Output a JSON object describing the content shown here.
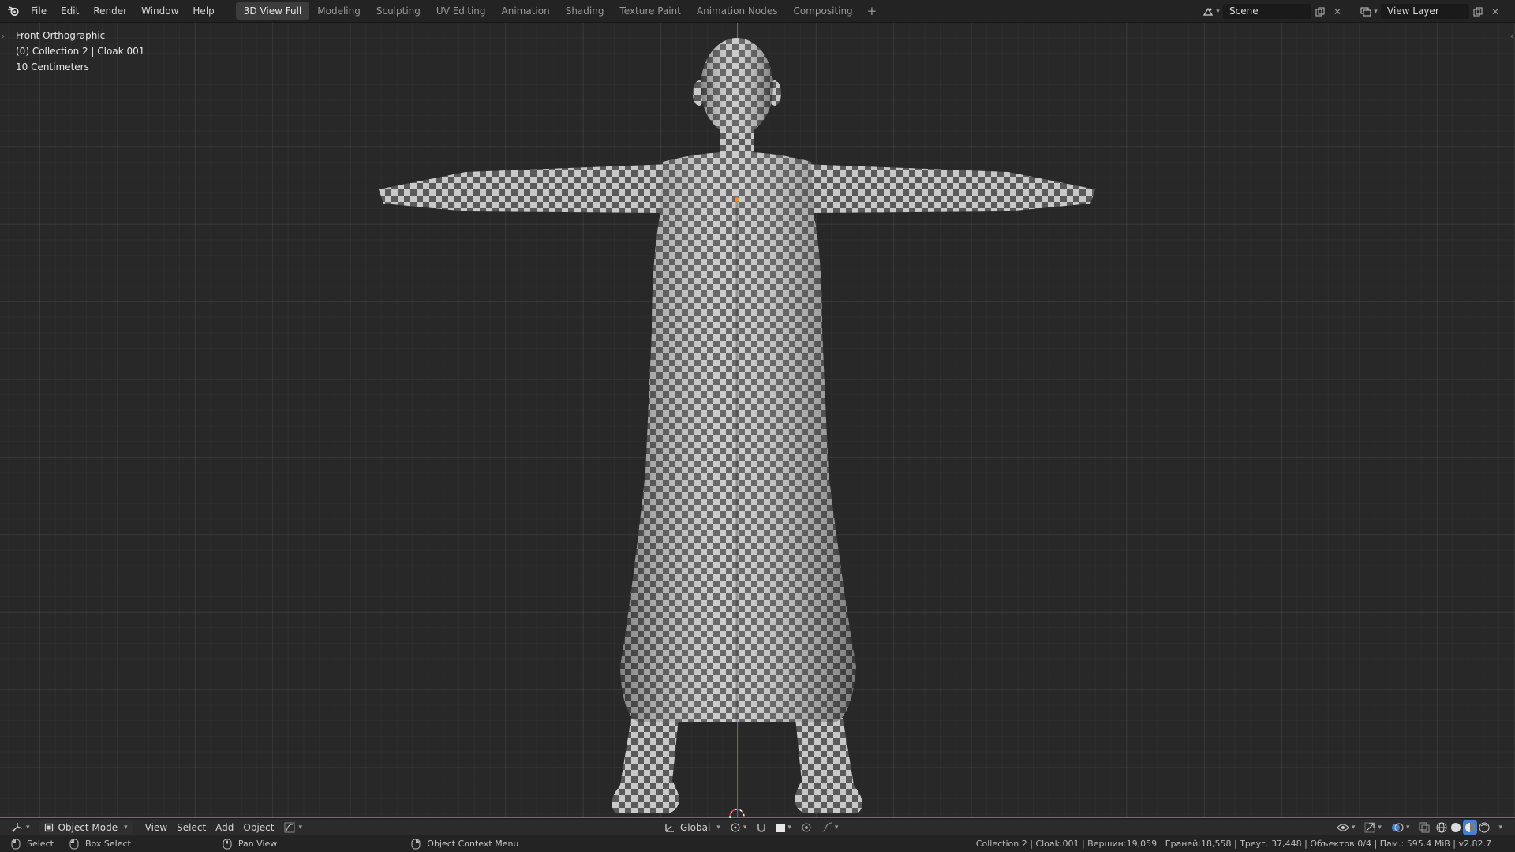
{
  "menu": {
    "items": [
      "File",
      "Edit",
      "Render",
      "Window",
      "Help"
    ]
  },
  "workspaces": {
    "tabs": [
      "3D View Full",
      "Modeling",
      "Sculpting",
      "UV Editing",
      "Animation",
      "Shading",
      "Texture Paint",
      "Animation Nodes",
      "Compositing"
    ],
    "active_index": 0,
    "add_label": "+"
  },
  "scene": {
    "name": "Scene"
  },
  "view_layer": {
    "name": "View Layer"
  },
  "viewport": {
    "view_name": "Front Orthographic",
    "collection_info": "(0) Collection 2 | Cloak.001",
    "scale_info": "10 Centimeters"
  },
  "header3d": {
    "mode": "Object Mode",
    "menus": [
      "View",
      "Select",
      "Add",
      "Object"
    ],
    "orientation": "Global"
  },
  "status": {
    "hints": [
      {
        "label": "Select"
      },
      {
        "label": "Box Select"
      },
      {
        "label": "Pan View"
      },
      {
        "label": "Object Context Menu"
      }
    ],
    "stats": "Collection 2 | Cloak.001 | Вершин:19,059 | Граней:18,558 | Треуг.:37,448 | Объектов:0/4 | Пам.: 595.4 MiB | v2.82.7"
  },
  "colors": {
    "axis_z": "#2f6fd1",
    "axis_x": "#d0464a",
    "active_tab": "#3c3c3c",
    "origin_dot": "#e8902a"
  }
}
